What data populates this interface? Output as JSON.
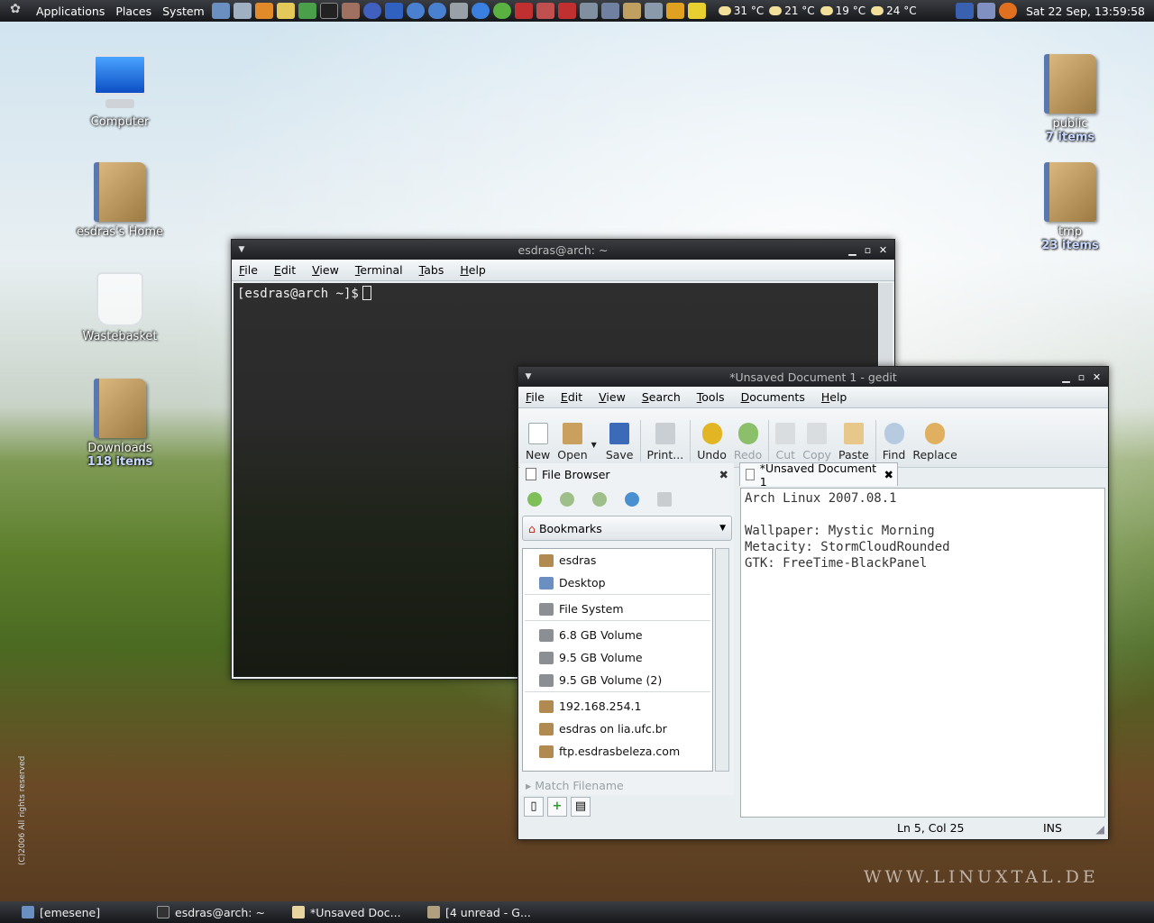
{
  "top_panel": {
    "menus": [
      "Applications",
      "Places",
      "System"
    ],
    "weather": [
      "31 °C",
      "21 °C",
      "19 °C",
      "24 °C"
    ],
    "clock": "Sat 22 Sep, 13:59:58"
  },
  "desktop": {
    "icons_left": [
      {
        "label": "Computer",
        "sub": ""
      },
      {
        "label": "esdras's Home",
        "sub": ""
      },
      {
        "label": "Wastebasket",
        "sub": ""
      },
      {
        "label": "Downloads",
        "sub": "118 items"
      }
    ],
    "icons_right": [
      {
        "label": "public",
        "sub": "7 items"
      },
      {
        "label": "tmp",
        "sub": "23 items"
      }
    ],
    "copyright": "(C)2006 All rights reserved",
    "watermark": "WWW.LINUXTAL.DE"
  },
  "terminal": {
    "title": "esdras@arch: ~",
    "menus": [
      "File",
      "Edit",
      "View",
      "Terminal",
      "Tabs",
      "Help"
    ],
    "prompt": "[esdras@arch ~]$"
  },
  "gedit": {
    "title": "*Unsaved Document 1 - gedit",
    "menus": [
      "File",
      "Edit",
      "View",
      "Search",
      "Tools",
      "Documents",
      "Help"
    ],
    "toolbar": {
      "new": "New",
      "open": "Open",
      "save": "Save",
      "print": "Print...",
      "undo": "Undo",
      "redo": "Redo",
      "cut": "Cut",
      "copy": "Copy",
      "paste": "Paste",
      "find": "Find",
      "replace": "Replace"
    },
    "side_pane": {
      "title": "File Browser",
      "combo": "Bookmarks",
      "bookmarks": [
        "esdras",
        "Desktop",
        "File System",
        "6.8 GB Volume",
        "9.5 GB Volume",
        "9.5 GB Volume (2)",
        "192.168.254.1",
        "esdras on lia.ufc.br",
        "ftp.esdrasbeleza.com"
      ],
      "match_label": "Match Filename"
    },
    "tab_label": "*Unsaved Document 1",
    "document_lines": [
      "Arch Linux 2007.08.1",
      "",
      "Wallpaper: Mystic Morning",
      "Metacity: StormCloudRounded",
      "GTK: FreeTime-BlackPanel"
    ],
    "status": {
      "position": "Ln 5, Col 25",
      "mode": "INS"
    }
  },
  "taskbar": [
    "[emesene]",
    "esdras@arch: ~",
    "*Unsaved Doc...",
    "[4 unread - G..."
  ]
}
